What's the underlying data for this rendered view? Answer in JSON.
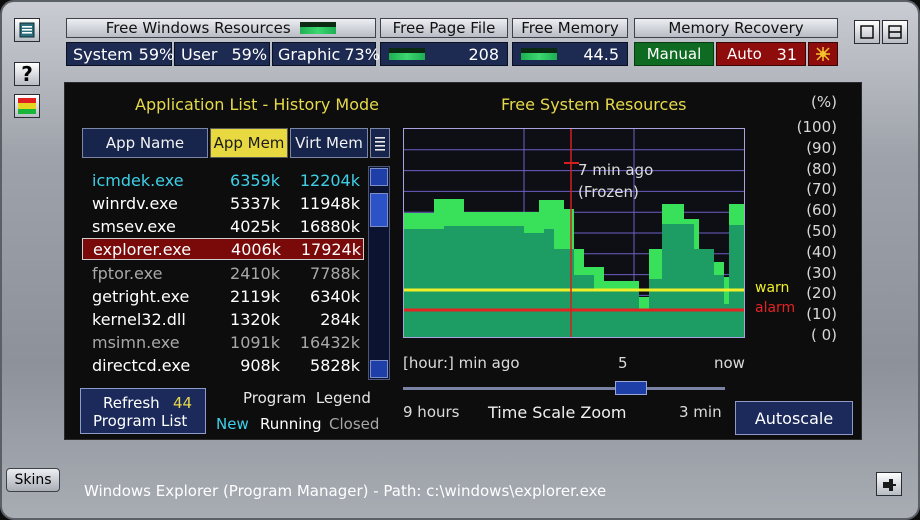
{
  "top": {
    "resources_label": "Free Windows Resources",
    "page_file_label": "Free Page File",
    "memory_label": "Free Memory",
    "recovery_label": "Memory Recovery",
    "system_label": "System",
    "system_value": "59%",
    "user_label": "User",
    "user_value": "59%",
    "graphic_label": "Graphic",
    "graphic_value": "73%",
    "page_file_value": "208",
    "memory_value": "44.5",
    "manual_label": "Manual",
    "auto_label": "Auto",
    "auto_value": "31"
  },
  "side": {
    "help_label": "?"
  },
  "app_list": {
    "title": "Application List - History Mode",
    "headers": {
      "name": "App Name",
      "app_mem": "App Mem",
      "virt_mem": "Virt Mem"
    },
    "rows": [
      {
        "name": "icmdek.exe",
        "app": "6359k",
        "virt": "12204k",
        "state": "new"
      },
      {
        "name": "winrdv.exe",
        "app": "5337k",
        "virt": "11948k",
        "state": "running"
      },
      {
        "name": "smsev.exe",
        "app": "4025k",
        "virt": "16880k",
        "state": "running"
      },
      {
        "name": "explorer.exe",
        "app": "4006k",
        "virt": "17924k",
        "state": "selected"
      },
      {
        "name": "fptor.exe",
        "app": "2410k",
        "virt": "7788k",
        "state": "closed"
      },
      {
        "name": "getright.exe",
        "app": "2119k",
        "virt": "6340k",
        "state": "running"
      },
      {
        "name": "kernel32.dll",
        "app": "1320k",
        "virt": "284k",
        "state": "running"
      },
      {
        "name": "msimn.exe",
        "app": "1091k",
        "virt": "16432k",
        "state": "closed"
      },
      {
        "name": "directcd.exe",
        "app": "908k",
        "virt": "5828k",
        "state": "running"
      }
    ],
    "refresh_label_1": "Refresh",
    "refresh_label_2": "Program List",
    "refresh_count": "44",
    "legend_title": "Program  Legend",
    "legend_new": "New",
    "legend_running": "Running",
    "legend_closed": "Closed"
  },
  "graph": {
    "title": "Free System Resources",
    "y_unit": "(%)",
    "y_ticks": [
      "(100)",
      "(90)",
      "(80)",
      "(70)",
      "(60)",
      "(50)",
      "(40)",
      "(30)",
      "(20)",
      "(10)",
      "( 0)"
    ],
    "warn_label": "warn",
    "alarm_label": "alarm",
    "marker_label_1": "7 min ago",
    "marker_label_2": "(Frozen)",
    "x_left": "[hour:] min ago",
    "x_mid": "5",
    "x_right": "now",
    "zoom_left": "9 hours",
    "zoom_label": "Time Scale Zoom",
    "zoom_right": "3 min",
    "autoscale_label": "Autoscale",
    "colors": {
      "line": "#39e05a",
      "fill": "#1d9c63",
      "warn": "#f0ee2a",
      "alarm": "#e42323",
      "marker": "#d61e1e"
    }
  },
  "bottom": {
    "skins_label": "Skins",
    "status_text": "Windows Explorer (Program Manager)  - Path: c:\\windows\\explorer.exe"
  }
}
